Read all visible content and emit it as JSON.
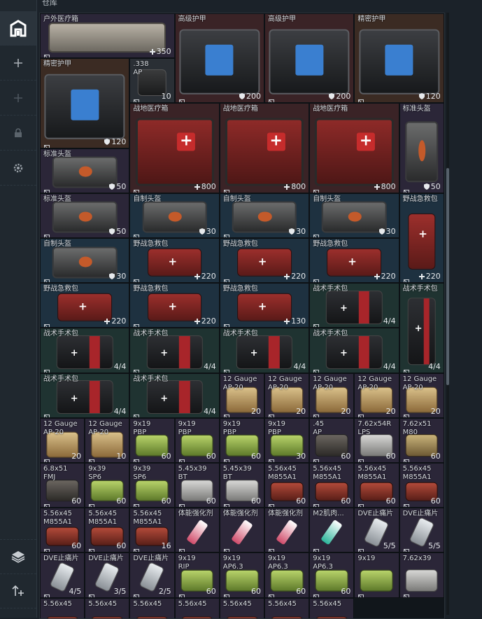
{
  "window": {
    "title": "仓库"
  },
  "sidebar": {
    "items": [
      {
        "name": "stash-icon",
        "active": true
      },
      {
        "name": "plus-icon"
      },
      {
        "name": "plus-icon-disabled"
      },
      {
        "name": "lock-icon"
      },
      {
        "name": "gear-icon"
      },
      {
        "name": "layers-icon"
      },
      {
        "name": "sort-icon"
      }
    ]
  },
  "stash": {
    "cells": [
      {
        "name": "户外医疗箱",
        "qty": "350",
        "qtyIcon": "plus",
        "type": "medbag",
        "bg": "purple"
      },
      {
        "name": "高级护甲",
        "qty": "200",
        "qtyIcon": "shield",
        "type": "armor",
        "bg": "red"
      },
      {
        "name": "高级护甲",
        "qty": "200",
        "qtyIcon": "shield",
        "type": "armor",
        "bg": "red"
      },
      {
        "name": "精密护甲",
        "qty": "120",
        "qtyIcon": "shield",
        "type": "armor",
        "bg": "brown"
      },
      {
        "name": "精密护甲",
        "qty": "120",
        "qtyIcon": "shield",
        "type": "armor",
        "bg": "brown"
      },
      {
        "name": ".338",
        "name2": "AP",
        "qty": "10",
        "type": "ammo338",
        "bg": "gray"
      },
      {
        "name": "战地医疗箱",
        "qty": "800",
        "qtyIcon": "plus",
        "type": "firstaid",
        "bg": "red"
      },
      {
        "name": "战地医疗箱",
        "qty": "800",
        "qtyIcon": "plus",
        "type": "firstaid",
        "bg": "red"
      },
      {
        "name": "战地医疗箱",
        "qty": "800",
        "qtyIcon": "plus",
        "type": "firstaid",
        "bg": "red"
      },
      {
        "name": "标准头盔",
        "qty": "50",
        "qtyIcon": "shield",
        "type": "helmet",
        "bg": "purple"
      },
      {
        "name": "标准头盔",
        "qty": "50",
        "qtyIcon": "shield",
        "type": "helmet",
        "bg": "purple"
      },
      {
        "name": "标准头盔",
        "qty": "50",
        "qtyIcon": "shield",
        "type": "helmet",
        "bg": "purple"
      },
      {
        "name": "自制头盔",
        "qty": "30",
        "qtyIcon": "shield",
        "type": "helmet",
        "bg": "blue"
      },
      {
        "name": "自制头盔",
        "qty": "30",
        "qtyIcon": "shield",
        "type": "helmet",
        "bg": "blue"
      },
      {
        "name": "自制头盔",
        "qty": "30",
        "qtyIcon": "shield",
        "type": "helmet",
        "bg": "blue"
      },
      {
        "name": "野战急救包",
        "qty": "220",
        "qtyIcon": "plus",
        "type": "kit",
        "bg": "blue"
      },
      {
        "name": "自制头盔",
        "qty": "30",
        "qtyIcon": "shield",
        "type": "helmet",
        "bg": "blue"
      },
      {
        "name": "野战急救包",
        "qty": "220",
        "qtyIcon": "plus",
        "type": "kit",
        "bg": "blue"
      },
      {
        "name": "野战急救包",
        "qty": "220",
        "qtyIcon": "plus",
        "type": "kit",
        "bg": "blue"
      },
      {
        "name": "野战急救包",
        "qty": "220",
        "qtyIcon": "plus",
        "type": "kit",
        "bg": "blue"
      },
      {
        "name": "野战急救包",
        "qty": "220",
        "qtyIcon": "plus",
        "type": "kit",
        "bg": "blue"
      },
      {
        "name": "野战急救包",
        "qty": "220",
        "qtyIcon": "plus",
        "type": "kit",
        "bg": "blue"
      },
      {
        "name": "野战急救包",
        "qty": "130",
        "qtyIcon": "plus",
        "type": "kit",
        "bg": "blue"
      },
      {
        "name": "战术手术包",
        "qty": "4/4",
        "type": "tac",
        "bg": "teal"
      },
      {
        "name": "战术手术包",
        "qty": "4/4",
        "type": "tac",
        "bg": "teal"
      },
      {
        "name": "战术手术包",
        "qty": "4/4",
        "type": "tac",
        "bg": "teal"
      },
      {
        "name": "战术手术包",
        "qty": "4/4",
        "type": "tac",
        "bg": "teal"
      },
      {
        "name": "战术手术包",
        "qty": "4/4",
        "type": "tac",
        "bg": "teal"
      },
      {
        "name": "战术手术包",
        "qty": "4/4",
        "type": "tac",
        "bg": "teal"
      },
      {
        "name": "战术手术包",
        "qty": "4/4",
        "type": "tac",
        "bg": "teal"
      },
      {
        "name": "战术手术包",
        "qty": "4/4",
        "type": "tac",
        "bg": "teal"
      },
      {
        "name": "12 Gauge",
        "name2": "AP-20",
        "qty": "20",
        "type": "ammo-box",
        "bg": "purple"
      },
      {
        "name": "12 Gauge",
        "name2": "AP-20",
        "qty": "20",
        "type": "ammo-box",
        "bg": "purple"
      },
      {
        "name": "12 Gauge",
        "name2": "AP-20",
        "qty": "20",
        "type": "ammo-box",
        "bg": "purple"
      },
      {
        "name": "12 Gauge",
        "name2": "AP-20",
        "qty": "20",
        "type": "ammo-box",
        "bg": "purple"
      },
      {
        "name": "12 Gauge",
        "name2": "AP-20",
        "qty": "20",
        "type": "ammo-box",
        "bg": "purple"
      },
      {
        "name": "12 Gauge",
        "name2": "AP-20",
        "qty": "20",
        "type": "ammo-box",
        "bg": "purple"
      },
      {
        "name": "12 Gauge",
        "name2": "AP-20",
        "qty": "10",
        "type": "ammo-box",
        "bg": "purple"
      },
      {
        "name": "9x19",
        "name2": "PBP",
        "qty": "60",
        "type": "ammo-green",
        "bg": "purple"
      },
      {
        "name": "9x19",
        "name2": "PBP",
        "qty": "60",
        "type": "ammo-green",
        "bg": "purple"
      },
      {
        "name": "9x19",
        "name2": "PBP",
        "qty": "60",
        "type": "ammo-green",
        "bg": "purple"
      },
      {
        "name": "9x19",
        "name2": "PBP",
        "qty": "30",
        "type": "ammo-green",
        "bg": "purple"
      },
      {
        "name": ".45",
        "name2": "AP",
        "qty": "60",
        "type": "ammo-dark",
        "bg": "purple"
      },
      {
        "name": "7.62x54R",
        "name2": "LPS",
        "qty": "60",
        "type": "ammo-gray",
        "bg": "purple"
      },
      {
        "name": "7.62x51",
        "name2": "M80",
        "qty": "60",
        "type": "ammo-tan",
        "bg": "purple"
      },
      {
        "name": "6.8x51",
        "name2": "FMJ",
        "qty": "60",
        "type": "ammo-dark",
        "bg": "purple"
      },
      {
        "name": "9x39",
        "name2": "SP6",
        "qty": "60",
        "type": "ammo-green",
        "bg": "purple"
      },
      {
        "name": "9x39",
        "name2": "SP6",
        "qty": "60",
        "type": "ammo-green",
        "bg": "purple"
      },
      {
        "name": "5.45x39",
        "name2": "BT",
        "qty": "60",
        "type": "ammo-gray",
        "bg": "purple"
      },
      {
        "name": "5.45x39",
        "name2": "BT",
        "qty": "60",
        "type": "ammo-gray",
        "bg": "purple"
      },
      {
        "name": "5.56x45",
        "name2": "M855A1",
        "qty": "60",
        "type": "ammo-red",
        "bg": "purple"
      },
      {
        "name": "5.56x45",
        "name2": "M855A1",
        "qty": "60",
        "type": "ammo-red",
        "bg": "purple"
      },
      {
        "name": "5.56x45",
        "name2": "M855A1",
        "qty": "60",
        "type": "ammo-red",
        "bg": "purple"
      },
      {
        "name": "5.56x45",
        "name2": "M855A1",
        "qty": "60",
        "type": "ammo-red",
        "bg": "purple"
      },
      {
        "name": "5.56x45",
        "name2": "M855A1",
        "qty": "60",
        "type": "ammo-red",
        "bg": "purple"
      },
      {
        "name": "5.56x45",
        "name2": "M855A1",
        "qty": "60",
        "type": "ammo-red",
        "bg": "purple"
      },
      {
        "name": "5.56x45",
        "name2": "M855A1",
        "qty": "16",
        "type": "ammo-red",
        "bg": "purple"
      },
      {
        "name": "体能强化剂",
        "qty": "",
        "type": "syringe",
        "bg": "purple"
      },
      {
        "name": "体能强化剂",
        "qty": "",
        "type": "syringe",
        "bg": "purple"
      },
      {
        "name": "体能强化剂",
        "qty": "",
        "type": "syringe",
        "bg": "purple"
      },
      {
        "name": "M2肌肉...",
        "qty": "",
        "type": "syringe-teal",
        "bg": "purple"
      },
      {
        "name": "DVE止痛片",
        "qty": "5/5",
        "type": "painkiller",
        "bg": "purple"
      },
      {
        "name": "DVE止痛片",
        "qty": "5/5",
        "type": "painkiller",
        "bg": "purple"
      },
      {
        "name": "DVE止痛片",
        "qty": "4/5",
        "type": "painkiller",
        "bg": "purple"
      },
      {
        "name": "DVE止痛片",
        "qty": "3/5",
        "type": "painkiller",
        "bg": "purple"
      },
      {
        "name": "DVE止痛片",
        "qty": "2/5",
        "type": "painkiller",
        "bg": "purple"
      },
      {
        "name": "9x19",
        "name2": "RIP",
        "qty": "60",
        "type": "ammo-green",
        "bg": "purple"
      },
      {
        "name": "9x19",
        "name2": "AP6.3",
        "qty": "60",
        "type": "ammo-green",
        "bg": "purple"
      },
      {
        "name": "9x19",
        "name2": "AP6.3",
        "qty": "60",
        "type": "ammo-green",
        "bg": "purple"
      },
      {
        "name": "9x19",
        "name2": "AP6.3",
        "qty": "60",
        "type": "ammo-green",
        "bg": "purple"
      },
      {
        "name": "9x19",
        "qty": "",
        "type": "ammo-green",
        "bg": "purple"
      },
      {
        "name": "7.62x39",
        "qty": "",
        "type": "ammo-gray",
        "bg": "purple"
      },
      {
        "name": "5.56x45",
        "qty": "",
        "type": "ammo-red",
        "bg": "purple"
      },
      {
        "name": "5.56x45",
        "qty": "",
        "type": "ammo-red",
        "bg": "purple"
      },
      {
        "name": "5.56x45",
        "qty": "",
        "type": "ammo-red",
        "bg": "purple"
      },
      {
        "name": "5.56x45",
        "qty": "",
        "type": "ammo-red",
        "bg": "purple"
      },
      {
        "name": "5.56x45",
        "qty": "",
        "type": "ammo-red",
        "bg": "purple"
      },
      {
        "name": "5.56x45",
        "qty": "",
        "type": "ammo-red",
        "bg": "purple"
      },
      {
        "name": "5.56x45",
        "qty": "",
        "type": "ammo-red",
        "bg": "purple"
      }
    ]
  }
}
